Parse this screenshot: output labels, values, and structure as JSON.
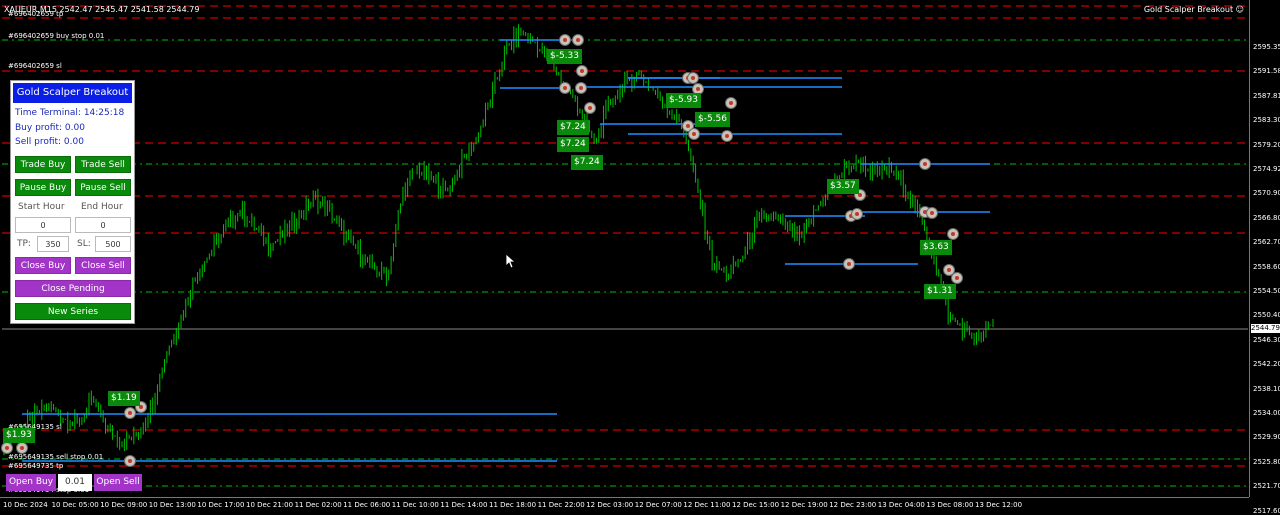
{
  "header": {
    "symbol_info": "XAUEUR,M15  2542.47 2545.47 2541.58 2544.79",
    "ea_name": "Gold Scalper Breakout ☺"
  },
  "order_labels": [
    {
      "text": "#696402659 tp"
    },
    {
      "text": "#696402659 buy stop 0.01"
    },
    {
      "text": "#696402659 sl"
    },
    {
      "text": "#695649135 sl"
    },
    {
      "text": "#695649135 sell stop 0.01"
    },
    {
      "text": "#695649735 tp"
    },
    {
      "text": "#695649734 stop 0.01"
    }
  ],
  "price_axis": {
    "ticks": [
      "2595.35",
      "2591.58",
      "2587.81",
      "2583.30",
      "2579.20",
      "2574.92",
      "2570.90",
      "2566.80",
      "2562.70",
      "2558.60",
      "2554.50",
      "2550.40",
      "2546.30",
      "2542.20",
      "2538.10",
      "2534.00",
      "2529.90",
      "2525.80",
      "2521.70",
      "2517.60"
    ],
    "current": "2544.79"
  },
  "time_axis": {
    "ticks": [
      "10 Dec 2024",
      "10 Dec 05:00",
      "10 Dec 09:00",
      "10 Dec 13:00",
      "10 Dec 17:00",
      "10 Dec 21:00",
      "11 Dec 02:00",
      "11 Dec 06:00",
      "11 Dec 10:00",
      "11 Dec 14:00",
      "11 Dec 18:00",
      "11 Dec 22:00",
      "12 Dec 03:00",
      "12 Dec 07:00",
      "12 Dec 11:00",
      "12 Dec 15:00",
      "12 Dec 19:00",
      "12 Dec 23:00",
      "13 Dec 04:00",
      "13 Dec 08:00",
      "13 Dec 12:00"
    ]
  },
  "panel": {
    "title": "Gold Scalper Breakout",
    "time_terminal": "Time Terminal: 14:25:18",
    "buy_profit": "Buy profit: 0.00",
    "sell_profit": "Sell profit: 0.00",
    "trade_buy": "Trade Buy",
    "trade_sell": "Trade Sell",
    "pause_buy": "Pause Buy",
    "pause_sell": "Pause Sell",
    "start_hour_label": "Start Hour",
    "end_hour_label": "End Hour",
    "start_hour": "0",
    "end_hour": "0",
    "tp_label": "TP:",
    "tp_value": "350",
    "sl_label": "SL:",
    "sl_value": "500",
    "close_buy": "Close Buy",
    "close_sell": "Close Sell",
    "close_pending": "Close Pending",
    "new_series": "New Series"
  },
  "profit_tags": [
    "$1.93",
    "$1.19",
    "$-5.33",
    "$7.24",
    "$7.24",
    "$7.24",
    "$-5.93",
    "$-5.56",
    "$3.57",
    "$3.63",
    "$1.31"
  ],
  "bottom_controls": {
    "open_buy": "Open Buy",
    "lot": "0.01",
    "open_sell": "Open Sell"
  },
  "colors": {
    "background": "#000000",
    "candles": "#00c000",
    "tp_line": "#ff0000",
    "stop_line": "#00c000",
    "order_line": "#1e90ff",
    "panel_title": "#0b1ee5",
    "green_button": "#0a8a0a",
    "purple_button": "#a235c8"
  },
  "chart_data": {
    "type": "line",
    "title": "",
    "series": [
      {
        "values": [
          2524,
          2526,
          2528,
          2530,
          2528,
          2527,
          2531,
          2526,
          2524,
          2525,
          2530,
          2539,
          2545,
          2552,
          2556,
          2560,
          2563,
          2560,
          2557,
          2559,
          2562,
          2565,
          2563,
          2559,
          2556,
          2553,
          2552,
          2566,
          2570,
          2568,
          2566,
          2571,
          2575,
          2582,
          2590,
          2593,
          2591,
          2588,
          2584,
          2580,
          2574,
          2581,
          2584,
          2586,
          2583,
          2580,
          2577,
          2566,
          2554,
          2552,
          2555,
          2561,
          2562,
          2560,
          2558,
          2563,
          2567,
          2570,
          2571,
          2569,
          2570,
          2567,
          2562,
          2555,
          2545,
          2543,
          2541,
          2544
        ]
      }
    ],
    "ylim": [
      2515,
      2598
    ],
    "grid": false
  }
}
